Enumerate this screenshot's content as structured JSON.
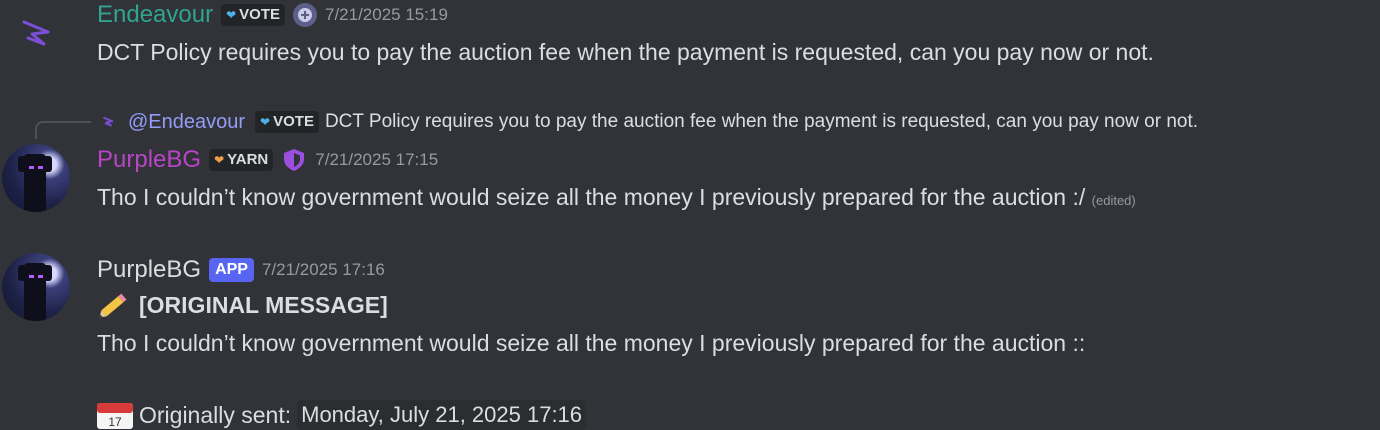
{
  "colors": {
    "endeavour": "#2fa48f",
    "purplebg": "#b845c6",
    "app_badge": "#5865f2",
    "mention": "#949cf7"
  },
  "messages": [
    {
      "username": "Endeavour",
      "badge": "VOTE",
      "badge_icon": "heart-icon",
      "role_icon": "plus-circle-icon",
      "timestamp": "7/21/2025 15:19",
      "text": "DCT Policy requires you to pay the auction fee when the payment is requested, can you pay now or not."
    },
    {
      "reply": {
        "mention": "@Endeavour",
        "badge": "VOTE",
        "text": "DCT Policy requires you to pay the auction fee when the payment is requested, can you pay now or not."
      },
      "username": "PurpleBG",
      "badge": "YARN",
      "badge_icon": "heart-icon",
      "role_icon": "shield-icon",
      "timestamp": "7/21/2025 17:15",
      "text": "Tho I couldn’t know government would seize all the money I previously prepared for the auction :/",
      "edited": "(edited)"
    },
    {
      "username": "PurpleBG",
      "badge": "APP",
      "timestamp": "7/21/2025 17:16",
      "header_icon": "pencil-icon",
      "header": "[ORIGINAL MESSAGE]",
      "text": "Tho I couldn’t know government would seize all the money I previously prepared for the auction ::",
      "sent_icon": "calendar-icon",
      "sent_label": "Originally sent:",
      "sent_date": "Monday, July 21, 2025 17:16"
    }
  ]
}
